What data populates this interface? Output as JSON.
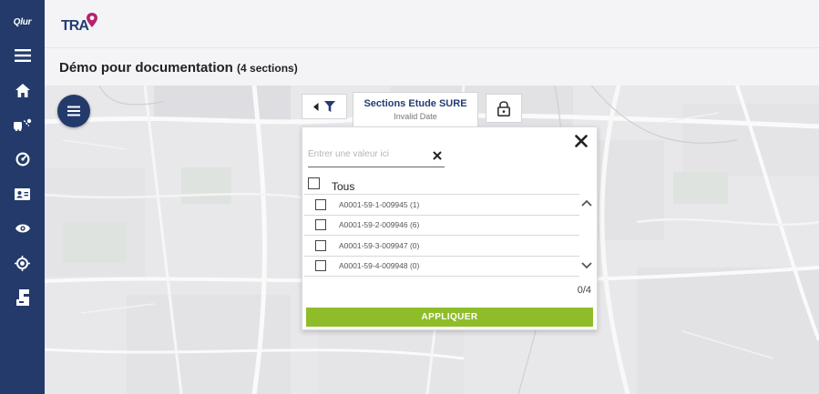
{
  "sidebar": {
    "logo_text": "Qlur",
    "items": [
      {
        "icon": "hamburger-menu-icon"
      },
      {
        "icon": "home-icon"
      },
      {
        "icon": "route-icon"
      },
      {
        "icon": "dashboard-gauge-icon"
      },
      {
        "icon": "contact-card-icon"
      },
      {
        "icon": "eye-icon"
      },
      {
        "icon": "crosshair-icon"
      },
      {
        "icon": "layers-icon"
      }
    ]
  },
  "header": {
    "brand": "TRA",
    "brand_pin_color": "#b8226b"
  },
  "page": {
    "title": "Démo pour documentation",
    "count": "(4 sections)"
  },
  "filter": {
    "select_title": "Sections Etude SURE",
    "select_subtitle": "Invalid Date",
    "search_placeholder": "Entrer une valeur ici",
    "all_label": "Tous",
    "items": [
      {
        "label": "A0001-59-1-009945 (1)"
      },
      {
        "label": "A0001-59-2-009946 (6)"
      },
      {
        "label": "A0001-59-3-009947 (0)"
      },
      {
        "label": "A0001-59-4-009948 (0)"
      }
    ],
    "counter": "0/4",
    "apply_label": "APPLIQUER"
  },
  "colors": {
    "nav_bg": "#233a6b",
    "accent_green": "#8fbd2a",
    "brand_blue": "#223c73"
  }
}
